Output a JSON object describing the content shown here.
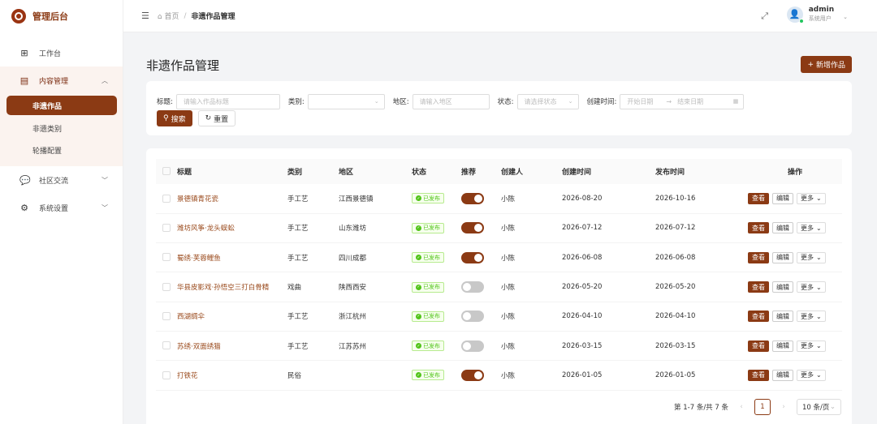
{
  "app": {
    "title": "管理后台"
  },
  "sidebar": {
    "items": [
      {
        "label": "工作台",
        "icon": "dashboard-icon"
      },
      {
        "label": "内容管理",
        "icon": "document-icon",
        "open": true,
        "children": [
          {
            "label": "非遗作品",
            "active": true
          },
          {
            "label": "非遗类别"
          },
          {
            "label": "轮播配置"
          }
        ]
      },
      {
        "label": "社区交流",
        "icon": "chat-icon"
      },
      {
        "label": "系统设置",
        "icon": "gear-icon"
      }
    ]
  },
  "header": {
    "breadcrumb": {
      "home": "首页",
      "current": "非遗作品管理"
    },
    "user": {
      "name": "admin",
      "role": "系统用户"
    }
  },
  "page": {
    "title": "非遗作品管理",
    "add_label": "新增作品"
  },
  "filter": {
    "title_label": "标题:",
    "title_placeholder": "请输入作品标题",
    "category_label": "类别:",
    "category_value": "",
    "region_label": "地区:",
    "region_placeholder": "请输入地区",
    "status_label": "状态:",
    "status_placeholder": "请选择状态",
    "created_label": "创建时间:",
    "start_placeholder": "开始日期",
    "end_placeholder": "结束日期",
    "search_label": "搜索",
    "reset_label": "重置"
  },
  "table": {
    "headers": {
      "title": "标题",
      "category": "类别",
      "region": "地区",
      "status": "状态",
      "recommend": "推荐",
      "creator": "创建人",
      "created": "创建时间",
      "published": "发布时间",
      "actions": "操作"
    },
    "view_label": "查看",
    "edit_label": "编辑",
    "more_label": "更多",
    "rows": [
      {
        "title": "景德镇青花瓷",
        "category": "手工艺",
        "region": "江西景德镇",
        "status": "已发布",
        "recommend": true,
        "creator": "小陈",
        "created": "2026-08-20",
        "published": "2026-10-16"
      },
      {
        "title": "潍坊风筝·龙头蜈蚣",
        "category": "手工艺",
        "region": "山东潍坊",
        "status": "已发布",
        "recommend": true,
        "creator": "小陈",
        "created": "2026-07-12",
        "published": "2026-07-12"
      },
      {
        "title": "蜀绣·芙蓉鲤鱼",
        "category": "手工艺",
        "region": "四川成都",
        "status": "已发布",
        "recommend": true,
        "creator": "小陈",
        "created": "2026-06-08",
        "published": "2026-06-08"
      },
      {
        "title": "华县皮影戏·孙悟空三打白骨精",
        "category": "戏曲",
        "region": "陕西西安",
        "status": "已发布",
        "recommend": false,
        "creator": "小陈",
        "created": "2026-05-20",
        "published": "2026-05-20"
      },
      {
        "title": "西湖绸伞",
        "category": "手工艺",
        "region": "浙江杭州",
        "status": "已发布",
        "recommend": false,
        "creator": "小陈",
        "created": "2026-04-10",
        "published": "2026-04-10"
      },
      {
        "title": "苏绣·双面绣猫",
        "category": "手工艺",
        "region": "江苏苏州",
        "status": "已发布",
        "recommend": false,
        "creator": "小陈",
        "created": "2026-03-15",
        "published": "2026-03-15"
      },
      {
        "title": "打铁花",
        "category": "民俗",
        "region": "",
        "status": "已发布",
        "recommend": true,
        "creator": "小陈",
        "created": "2026-01-05",
        "published": "2026-01-05"
      }
    ]
  },
  "pagination": {
    "summary": "第 1-7 条/共 7 条",
    "current_page": "1",
    "page_size": "10 条/页"
  },
  "colors": {
    "accent": "#8b3a14",
    "success": "#52c41a"
  }
}
